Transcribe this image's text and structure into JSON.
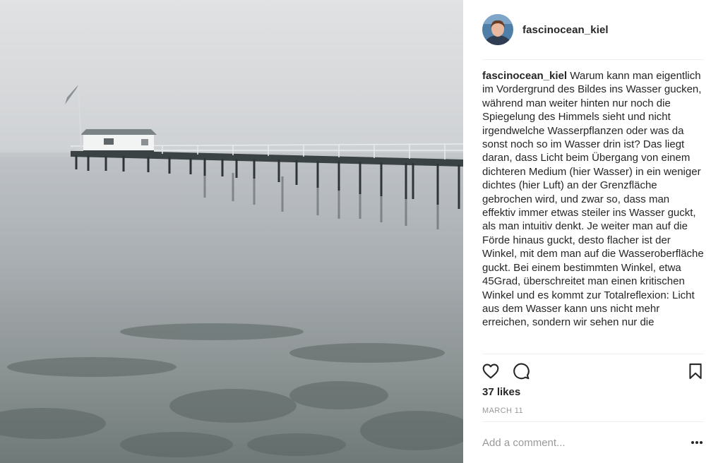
{
  "post": {
    "username": "fascinocean_kiel",
    "caption": {
      "user": "fascinocean_kiel",
      "text": "Warum kann man eigentlich im Vordergrund des Bildes ins Wasser gucken, während man weiter hinten nur noch die Spiegelung des Himmels sieht und nicht irgendwelche Wasserpflanzen oder was da sonst noch so im Wasser drin ist? Das liegt daran, dass Licht beim Übergang von einem dichteren Medium (hier Wasser) in ein weniger dichtes (hier Luft) an der Grenzfläche gebrochen wird, und zwar so, dass man effektiv immer etwas steiler ins Wasser guckt, als man intuitiv denkt. Je weiter man auf die Förde hinaus guckt, desto flacher ist der Winkel, mit dem man auf die Wasseroberfläche guckt. Bei einem bestimmten Winkel, etwa 45Grad, überschreitet man einen kritischen Winkel und es kommt zur Totalreflexion: Licht aus dem Wasser kann uns nicht mehr erreichen, sondern wir sehen nur die"
    },
    "likes": "37 likes",
    "date": "MARCH 11"
  },
  "comment_box": {
    "placeholder": "Add a comment..."
  },
  "icons": {
    "like": "heart-icon",
    "comment": "speech-bubble-icon",
    "save": "bookmark-icon",
    "more": "more-options-icon"
  },
  "colors": {
    "text": "#262626",
    "muted": "#999999",
    "divider": "#efefef"
  }
}
